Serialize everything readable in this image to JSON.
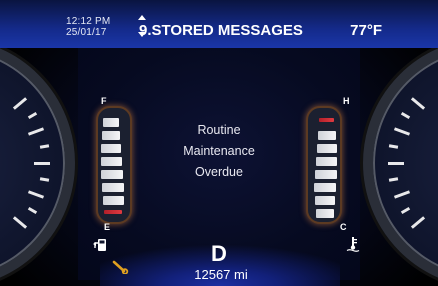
{
  "status_bar": {
    "time": "12:12 PM",
    "date": "25/01/17",
    "menu_title": "9.STORED MESSAGES",
    "outside_temp": "77°F"
  },
  "message": {
    "lines": [
      "Routine",
      "Maintenance",
      "Overdue"
    ]
  },
  "fuel_gauge": {
    "top_label": "F",
    "bottom_label": "E"
  },
  "temp_gauge": {
    "top_label": "H",
    "bottom_label": "C"
  },
  "gear": "D",
  "odometer": "12567 mi",
  "icons": {
    "menu_scroll": "up-down-arrows-icon",
    "fuel": "fuel-pump-icon",
    "coolant": "coolant-temperature-icon",
    "service": "wrench-icon"
  },
  "colors": {
    "header_blue": "#1a36a8",
    "gauge_glow": "#c07a3c",
    "warning_amber": "#e0a020",
    "text": "#ffffff"
  }
}
